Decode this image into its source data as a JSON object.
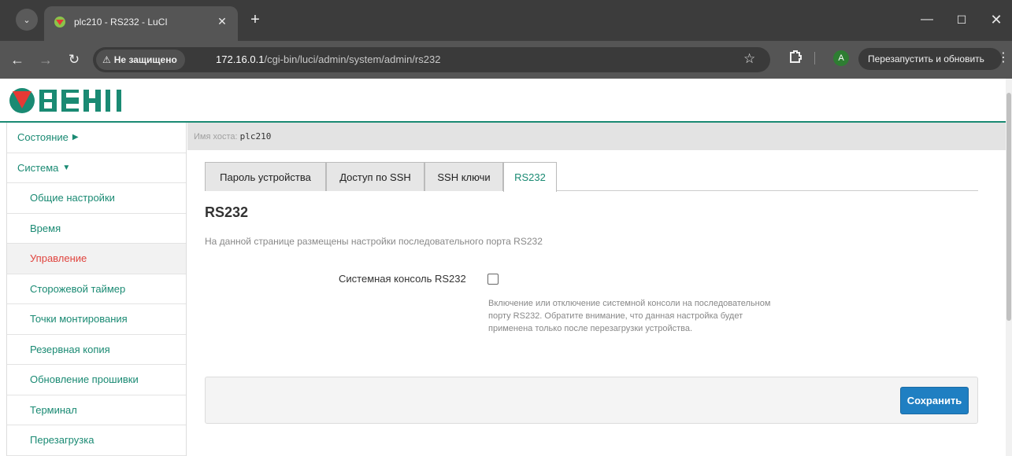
{
  "browser": {
    "tab_title": "plc210 - RS232 - LuCI",
    "security_label": "Не защищено",
    "url_host": "172.16.0.1",
    "url_path": "/cgi-bin/luci/admin/system/admin/rs232",
    "profile_initial": "A",
    "relaunch_label": "Перезапустить и обновить"
  },
  "logo_text": "ОВЕН",
  "sidebar": {
    "items": [
      {
        "label": "Состояние",
        "arrow": "▶"
      },
      {
        "label": "Система",
        "arrow": "▼"
      },
      {
        "label": "Общие настройки"
      },
      {
        "label": "Время"
      },
      {
        "label": "Управление"
      },
      {
        "label": "Сторожевой таймер"
      },
      {
        "label": "Точки монтирования"
      },
      {
        "label": "Резервная копия"
      },
      {
        "label": "Обновление прошивки"
      },
      {
        "label": "Терминал"
      },
      {
        "label": "Перезагрузка"
      }
    ]
  },
  "hostbar": {
    "label": "Имя хоста:",
    "value": "plc210"
  },
  "tabs": [
    {
      "label": "Пароль устройства"
    },
    {
      "label": "Доступ по SSH"
    },
    {
      "label": "SSH ключи"
    },
    {
      "label": "RS232"
    }
  ],
  "section": {
    "title": "RS232",
    "description": "На данной странице размещены настройки последовательного порта RS232"
  },
  "field": {
    "label": "Системная консоль RS232",
    "checked": false,
    "help": "Включение или отключение системной консоли на последовательном порту RS232. Обратите внимание, что данная настройка будет применена только после перезагрузки устройства."
  },
  "actions": {
    "save_label": "Сохранить"
  },
  "colors": {
    "accent": "#1a8a73",
    "active_menu": "#e0443e",
    "save_button": "#1f7fc2"
  }
}
